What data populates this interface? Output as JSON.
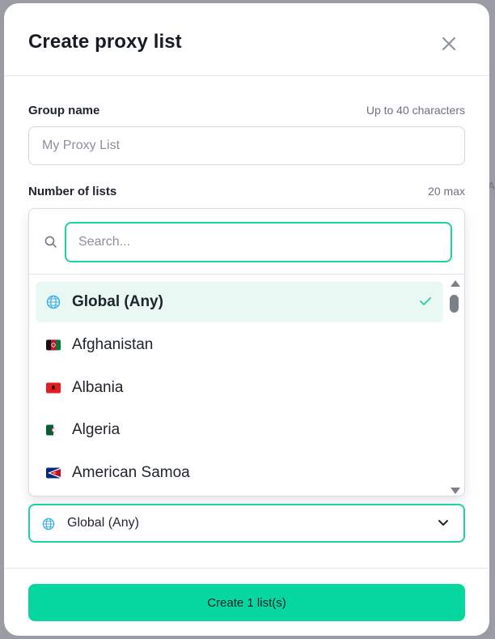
{
  "dialog": {
    "title": "Create proxy list",
    "close_icon": "close-icon"
  },
  "group_name": {
    "label": "Group name",
    "hint": "Up to 40 characters",
    "placeholder": "My Proxy List",
    "value": ""
  },
  "number_of_lists": {
    "label": "Number of lists",
    "hint": "20 max"
  },
  "country_dropdown": {
    "search_placeholder": "Search...",
    "search_icon": "search-icon",
    "options": [
      {
        "label": "Global (Any)",
        "flag": "globe-icon",
        "selected": true
      },
      {
        "label": "Afghanistan",
        "flag": "afghanistan-flag-icon",
        "selected": false
      },
      {
        "label": "Albania",
        "flag": "albania-flag-icon",
        "selected": false
      },
      {
        "label": "Algeria",
        "flag": "algeria-flag-icon",
        "selected": false
      },
      {
        "label": "American Samoa",
        "flag": "american-samoa-flag-icon",
        "selected": false
      }
    ],
    "selected_value": "Global (Any)"
  },
  "create_button": {
    "label": "Create 1 list(s)"
  },
  "colors": {
    "accent": "#06d6a0",
    "accent_border": "#1dd1a1",
    "selected_bg": "#e9f8f3",
    "title_text": "#171c24"
  }
}
